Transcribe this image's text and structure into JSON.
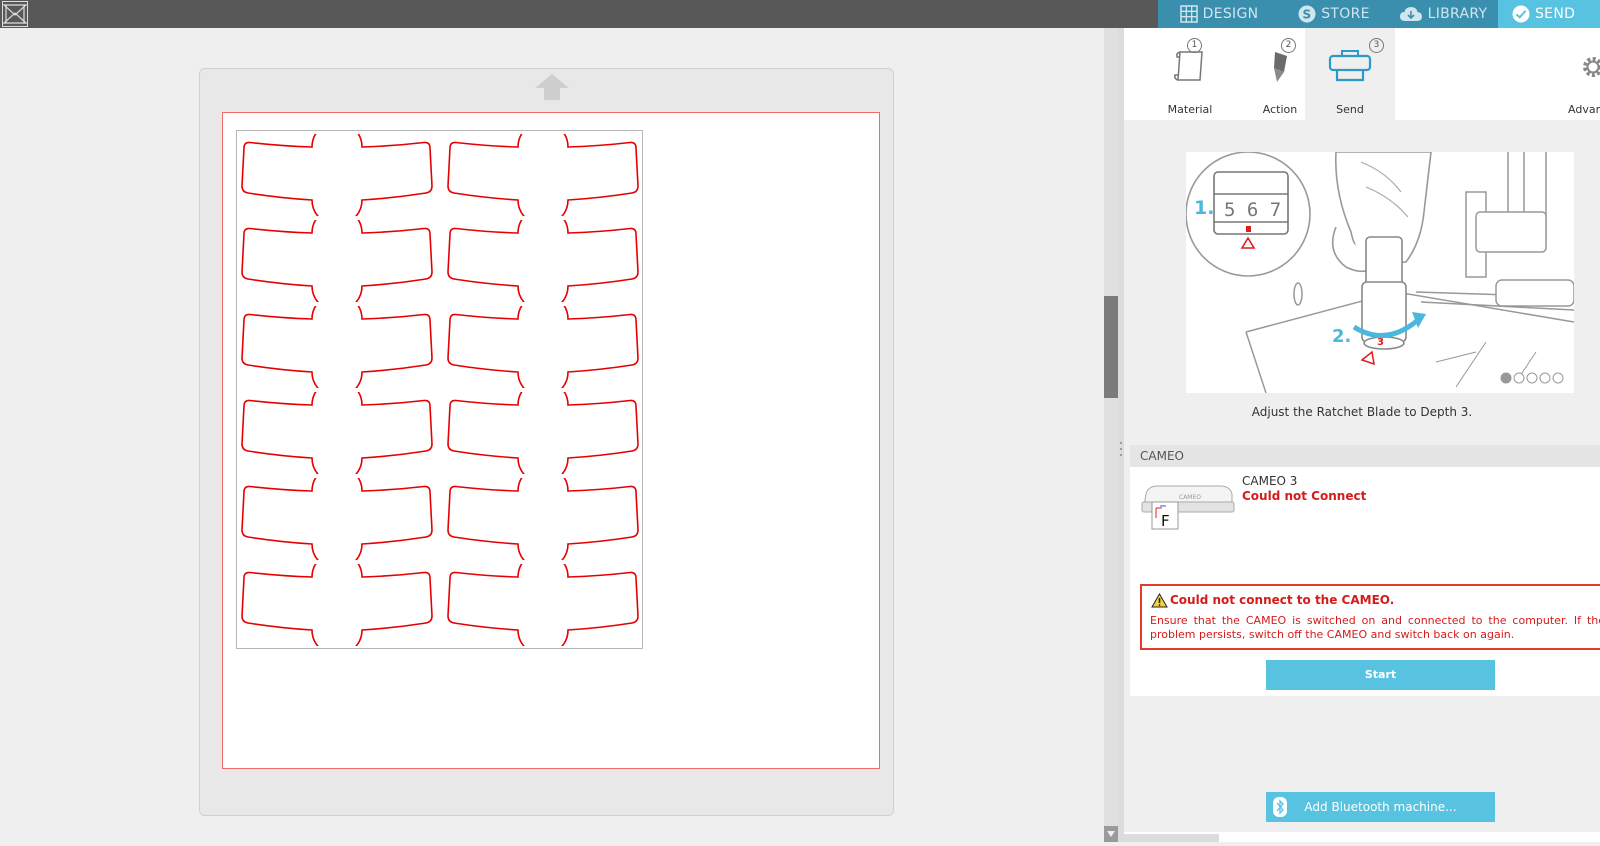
{
  "nav": {
    "tabs": [
      {
        "label": "DESIGN",
        "icon": "grid-icon"
      },
      {
        "label": "STORE",
        "icon": "store-s-icon"
      },
      {
        "label": "LIBRARY",
        "icon": "cloud-icon"
      },
      {
        "label": "SEND",
        "icon": "check-circle-icon",
        "active": true
      }
    ]
  },
  "steps": [
    {
      "num": "1",
      "label": "Material",
      "icon": "material-roll-icon"
    },
    {
      "num": "2",
      "label": "Action",
      "icon": "blade-icon"
    },
    {
      "num": "3",
      "label": "Send",
      "icon": "cutter-machine-icon",
      "active": true
    },
    {
      "num": "",
      "label": "Advan",
      "icon": "gear-icon"
    }
  ],
  "illustration": {
    "caption": "Adjust the Ratchet Blade to Depth 3.",
    "step1": "1.",
    "step2": "2.",
    "dial_digits": "5 6 7",
    "small_dial_digits": "3",
    "carousel_count": 5,
    "carousel_active": 1
  },
  "machine_section": {
    "title": "CAMEO",
    "machine_name": "CAMEO 3",
    "status": "Could not Connect",
    "badge_letter": "F",
    "brand": "CAMEO"
  },
  "error": {
    "title": "Could not connect to the CAMEO.",
    "message": "Ensure that the CAMEO is switched on and connected to the computer. If the problem persists, switch off the CAMEO and switch back on again."
  },
  "buttons": {
    "start": "Start",
    "bluetooth": "Add Bluetooth machine..."
  },
  "colors": {
    "accent": "#58c3e1",
    "nav_bg": "#3b8fae",
    "error": "#d71b1b",
    "cut_line": "#e60000"
  }
}
